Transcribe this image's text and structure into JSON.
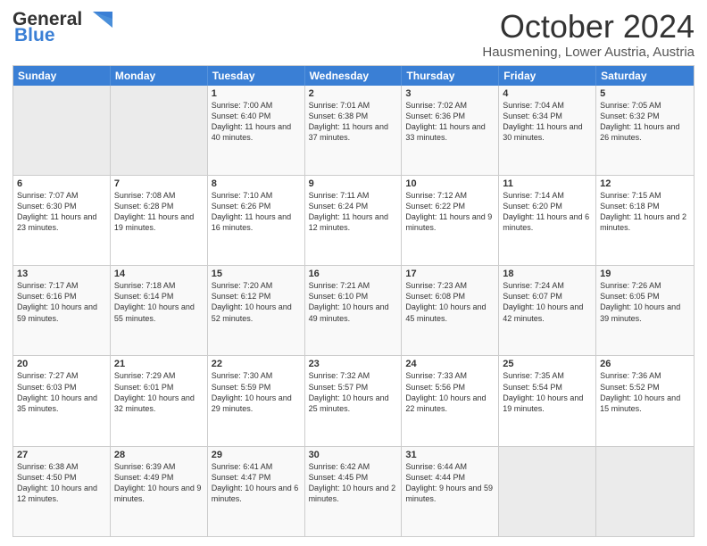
{
  "logo": {
    "general": "General",
    "blue": "Blue"
  },
  "title": "October 2024",
  "subtitle": "Hausmening, Lower Austria, Austria",
  "header_days": [
    "Sunday",
    "Monday",
    "Tuesday",
    "Wednesday",
    "Thursday",
    "Friday",
    "Saturday"
  ],
  "weeks": [
    [
      {
        "day": "",
        "sunrise": "",
        "sunset": "",
        "daylight": ""
      },
      {
        "day": "",
        "sunrise": "",
        "sunset": "",
        "daylight": ""
      },
      {
        "day": "1",
        "sunrise": "Sunrise: 7:00 AM",
        "sunset": "Sunset: 6:40 PM",
        "daylight": "Daylight: 11 hours and 40 minutes."
      },
      {
        "day": "2",
        "sunrise": "Sunrise: 7:01 AM",
        "sunset": "Sunset: 6:38 PM",
        "daylight": "Daylight: 11 hours and 37 minutes."
      },
      {
        "day": "3",
        "sunrise": "Sunrise: 7:02 AM",
        "sunset": "Sunset: 6:36 PM",
        "daylight": "Daylight: 11 hours and 33 minutes."
      },
      {
        "day": "4",
        "sunrise": "Sunrise: 7:04 AM",
        "sunset": "Sunset: 6:34 PM",
        "daylight": "Daylight: 11 hours and 30 minutes."
      },
      {
        "day": "5",
        "sunrise": "Sunrise: 7:05 AM",
        "sunset": "Sunset: 6:32 PM",
        "daylight": "Daylight: 11 hours and 26 minutes."
      }
    ],
    [
      {
        "day": "6",
        "sunrise": "Sunrise: 7:07 AM",
        "sunset": "Sunset: 6:30 PM",
        "daylight": "Daylight: 11 hours and 23 minutes."
      },
      {
        "day": "7",
        "sunrise": "Sunrise: 7:08 AM",
        "sunset": "Sunset: 6:28 PM",
        "daylight": "Daylight: 11 hours and 19 minutes."
      },
      {
        "day": "8",
        "sunrise": "Sunrise: 7:10 AM",
        "sunset": "Sunset: 6:26 PM",
        "daylight": "Daylight: 11 hours and 16 minutes."
      },
      {
        "day": "9",
        "sunrise": "Sunrise: 7:11 AM",
        "sunset": "Sunset: 6:24 PM",
        "daylight": "Daylight: 11 hours and 12 minutes."
      },
      {
        "day": "10",
        "sunrise": "Sunrise: 7:12 AM",
        "sunset": "Sunset: 6:22 PM",
        "daylight": "Daylight: 11 hours and 9 minutes."
      },
      {
        "day": "11",
        "sunrise": "Sunrise: 7:14 AM",
        "sunset": "Sunset: 6:20 PM",
        "daylight": "Daylight: 11 hours and 6 minutes."
      },
      {
        "day": "12",
        "sunrise": "Sunrise: 7:15 AM",
        "sunset": "Sunset: 6:18 PM",
        "daylight": "Daylight: 11 hours and 2 minutes."
      }
    ],
    [
      {
        "day": "13",
        "sunrise": "Sunrise: 7:17 AM",
        "sunset": "Sunset: 6:16 PM",
        "daylight": "Daylight: 10 hours and 59 minutes."
      },
      {
        "day": "14",
        "sunrise": "Sunrise: 7:18 AM",
        "sunset": "Sunset: 6:14 PM",
        "daylight": "Daylight: 10 hours and 55 minutes."
      },
      {
        "day": "15",
        "sunrise": "Sunrise: 7:20 AM",
        "sunset": "Sunset: 6:12 PM",
        "daylight": "Daylight: 10 hours and 52 minutes."
      },
      {
        "day": "16",
        "sunrise": "Sunrise: 7:21 AM",
        "sunset": "Sunset: 6:10 PM",
        "daylight": "Daylight: 10 hours and 49 minutes."
      },
      {
        "day": "17",
        "sunrise": "Sunrise: 7:23 AM",
        "sunset": "Sunset: 6:08 PM",
        "daylight": "Daylight: 10 hours and 45 minutes."
      },
      {
        "day": "18",
        "sunrise": "Sunrise: 7:24 AM",
        "sunset": "Sunset: 6:07 PM",
        "daylight": "Daylight: 10 hours and 42 minutes."
      },
      {
        "day": "19",
        "sunrise": "Sunrise: 7:26 AM",
        "sunset": "Sunset: 6:05 PM",
        "daylight": "Daylight: 10 hours and 39 minutes."
      }
    ],
    [
      {
        "day": "20",
        "sunrise": "Sunrise: 7:27 AM",
        "sunset": "Sunset: 6:03 PM",
        "daylight": "Daylight: 10 hours and 35 minutes."
      },
      {
        "day": "21",
        "sunrise": "Sunrise: 7:29 AM",
        "sunset": "Sunset: 6:01 PM",
        "daylight": "Daylight: 10 hours and 32 minutes."
      },
      {
        "day": "22",
        "sunrise": "Sunrise: 7:30 AM",
        "sunset": "Sunset: 5:59 PM",
        "daylight": "Daylight: 10 hours and 29 minutes."
      },
      {
        "day": "23",
        "sunrise": "Sunrise: 7:32 AM",
        "sunset": "Sunset: 5:57 PM",
        "daylight": "Daylight: 10 hours and 25 minutes."
      },
      {
        "day": "24",
        "sunrise": "Sunrise: 7:33 AM",
        "sunset": "Sunset: 5:56 PM",
        "daylight": "Daylight: 10 hours and 22 minutes."
      },
      {
        "day": "25",
        "sunrise": "Sunrise: 7:35 AM",
        "sunset": "Sunset: 5:54 PM",
        "daylight": "Daylight: 10 hours and 19 minutes."
      },
      {
        "day": "26",
        "sunrise": "Sunrise: 7:36 AM",
        "sunset": "Sunset: 5:52 PM",
        "daylight": "Daylight: 10 hours and 15 minutes."
      }
    ],
    [
      {
        "day": "27",
        "sunrise": "Sunrise: 6:38 AM",
        "sunset": "Sunset: 4:50 PM",
        "daylight": "Daylight: 10 hours and 12 minutes."
      },
      {
        "day": "28",
        "sunrise": "Sunrise: 6:39 AM",
        "sunset": "Sunset: 4:49 PM",
        "daylight": "Daylight: 10 hours and 9 minutes."
      },
      {
        "day": "29",
        "sunrise": "Sunrise: 6:41 AM",
        "sunset": "Sunset: 4:47 PM",
        "daylight": "Daylight: 10 hours and 6 minutes."
      },
      {
        "day": "30",
        "sunrise": "Sunrise: 6:42 AM",
        "sunset": "Sunset: 4:45 PM",
        "daylight": "Daylight: 10 hours and 2 minutes."
      },
      {
        "day": "31",
        "sunrise": "Sunrise: 6:44 AM",
        "sunset": "Sunset: 4:44 PM",
        "daylight": "Daylight: 9 hours and 59 minutes."
      },
      {
        "day": "",
        "sunrise": "",
        "sunset": "",
        "daylight": ""
      },
      {
        "day": "",
        "sunrise": "",
        "sunset": "",
        "daylight": ""
      }
    ]
  ]
}
